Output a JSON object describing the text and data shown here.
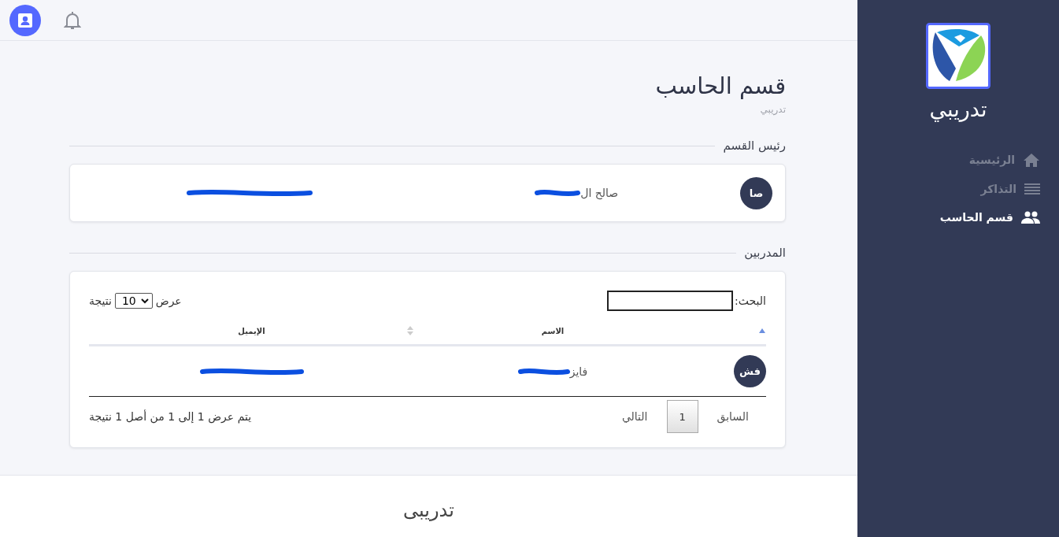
{
  "topbar": {
    "icons": [
      {
        "kind": "contact",
        "active": true
      },
      {
        "kind": "bell",
        "active": false
      }
    ]
  },
  "sidebar": {
    "brand": "تدريبي",
    "items": [
      {
        "label": "الرئيسية",
        "kind": "home",
        "selected": false
      },
      {
        "label": "التذاكر",
        "kind": "list",
        "selected": false
      },
      {
        "label": "قسم الحاسب",
        "kind": "people",
        "selected": true
      }
    ]
  },
  "page": {
    "title": "قسم الحاسب",
    "subtitle": "تدريبي"
  },
  "head_section": {
    "heading": "رئيس القسم",
    "person": {
      "initials": "صا",
      "name": "صالح ال",
      "name_redacted": true,
      "email_redacted": true
    }
  },
  "trainers_section": {
    "heading": "المدربين",
    "length_control": {
      "prefix": "عرض",
      "value": "10",
      "suffix": "نتيجة"
    },
    "search": {
      "label": "البحث:"
    },
    "columns": [
      {
        "sorted": true
      },
      {
        "label": "الاسم"
      },
      {
        "label": "الإيميل",
        "sorted": false
      }
    ],
    "rows": [
      {
        "initials": "فش",
        "name": "فايز",
        "name_redacted": true,
        "email_redacted": true
      }
    ],
    "info": "يتم عرض 1 إلى 1 من أصل 1 نتيجة",
    "pagination": {
      "previous": "السابق",
      "pages": [
        {
          "label": "1",
          "selected": true
        }
      ],
      "next": "التالي"
    }
  },
  "footer": {
    "brand": "تدريبى"
  }
}
